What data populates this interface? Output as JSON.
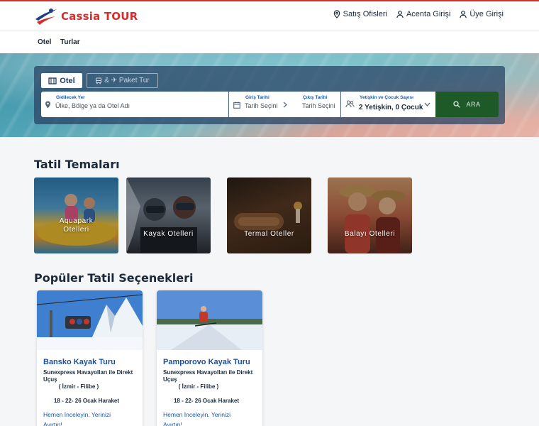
{
  "header": {
    "logo_text": "Cassia TOUR",
    "nav": [
      {
        "label": "Satış Ofisleri",
        "icon": "location-pin-icon"
      },
      {
        "label": "Acenta Girişi",
        "icon": "user-icon"
      },
      {
        "label": "Üye Girişi",
        "icon": "user-icon"
      }
    ]
  },
  "subnav": {
    "items": [
      "Otel",
      "Turlar"
    ]
  },
  "search": {
    "tab_hotel": "Otel",
    "tab_package": "& ✈ Paket Tur",
    "destination_label": "Gidilecek Yer",
    "destination_placeholder": "Ülke, Bölge ya da Otel Adı",
    "checkin_label": "Giriş Tarihi",
    "checkin_value": "Tarih Seçini",
    "checkout_label": "Çıkış Tarihi",
    "checkout_value": "Tarih Seçini",
    "guests_label": "Yetişkin ve Çocuk Sayısı",
    "guests_value": "2 Yetişkin, 0 Çocuk",
    "search_button": "ARA"
  },
  "themes": {
    "title": "Tatil Temaları",
    "items": [
      {
        "line1": "Aquapark",
        "line2": "Otelleri"
      },
      {
        "line1": "Kayak Otelleri",
        "line2": ""
      },
      {
        "line1": "Termal Oteller",
        "line2": ""
      },
      {
        "line1": "Balayı Otelleri",
        "line2": ""
      }
    ]
  },
  "popular": {
    "title": "Popüler Tatil Seçenekleri",
    "cards": [
      {
        "title": "Bansko Kayak Turu",
        "desc": "Sunexpress Havayolları ile Direkt Uçuş",
        "route": "( İzmir - Filibe )",
        "date": "18 - 22- 26 Ocak Haraket",
        "cta": "Hemen İnceleyin. Yerinizi Ayırtın!"
      },
      {
        "title": "Pamporovo Kayak Turu",
        "desc": "Sunexpress Havayolları ile Direkt Uçuş",
        "route": "( İzmir - Filibe )",
        "date": "18 - 22- 26 Ocak Haraket",
        "cta": "Hemen İnceleyin. Yerinizi Ayırtın!"
      }
    ]
  },
  "colors": {
    "brand_red": "#d32f2f",
    "search_button": "#1d5a28",
    "link_blue": "#1e57a6",
    "search_panel": "#264062"
  }
}
